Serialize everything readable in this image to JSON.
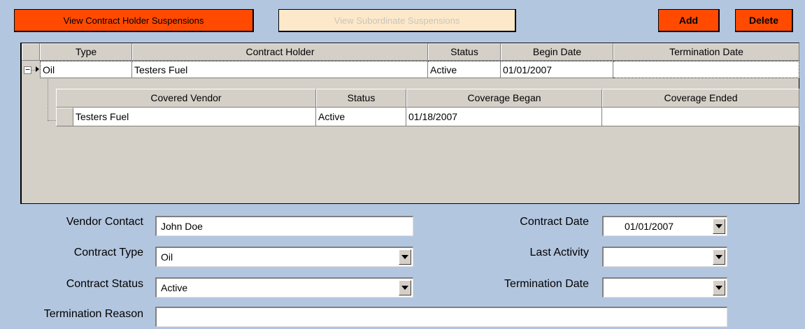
{
  "toolbar": {
    "contract_holder_label": "View Contract Holder Suspensions",
    "subordinate_label": "View Subordinate Suspensions",
    "add_label": "Add",
    "delete_label": "Delete"
  },
  "grid": {
    "columns": [
      "Type",
      "Contract Holder",
      "Status",
      "Begin Date",
      "Termination Date"
    ],
    "row": {
      "type": "Oil",
      "contract_holder": "Testers Fuel",
      "status": "Active",
      "begin_date": "01/01/2007",
      "termination_date": ""
    },
    "expander_icon": "minus-box-icon",
    "row_indicator_icon": "triangle-right-icon",
    "sub_columns": [
      "Covered Vendor",
      "Status",
      "Coverage Began",
      "Coverage Ended"
    ],
    "sub_row": {
      "covered_vendor": "Testers Fuel",
      "status": "Active",
      "coverage_began": "01/18/2007",
      "coverage_ended": ""
    }
  },
  "form": {
    "vendor_contact_label": "Vendor Contact",
    "vendor_contact_value": "John Doe",
    "contract_type_label": "Contract Type",
    "contract_type_value": "Oil",
    "contract_status_label": "Contract Status",
    "contract_status_value": "Active",
    "termination_reason_label": "Termination Reason",
    "termination_reason_value": "",
    "contract_date_label": "Contract Date",
    "contract_date_value": "01/01/2007",
    "last_activity_label": "Last Activity",
    "last_activity_value": "",
    "termination_date_label": "Termination Date",
    "termination_date_value": ""
  },
  "colors": {
    "background": "#b3c6df",
    "accent": "#ff4a00",
    "disabled": "#fde9c9"
  }
}
